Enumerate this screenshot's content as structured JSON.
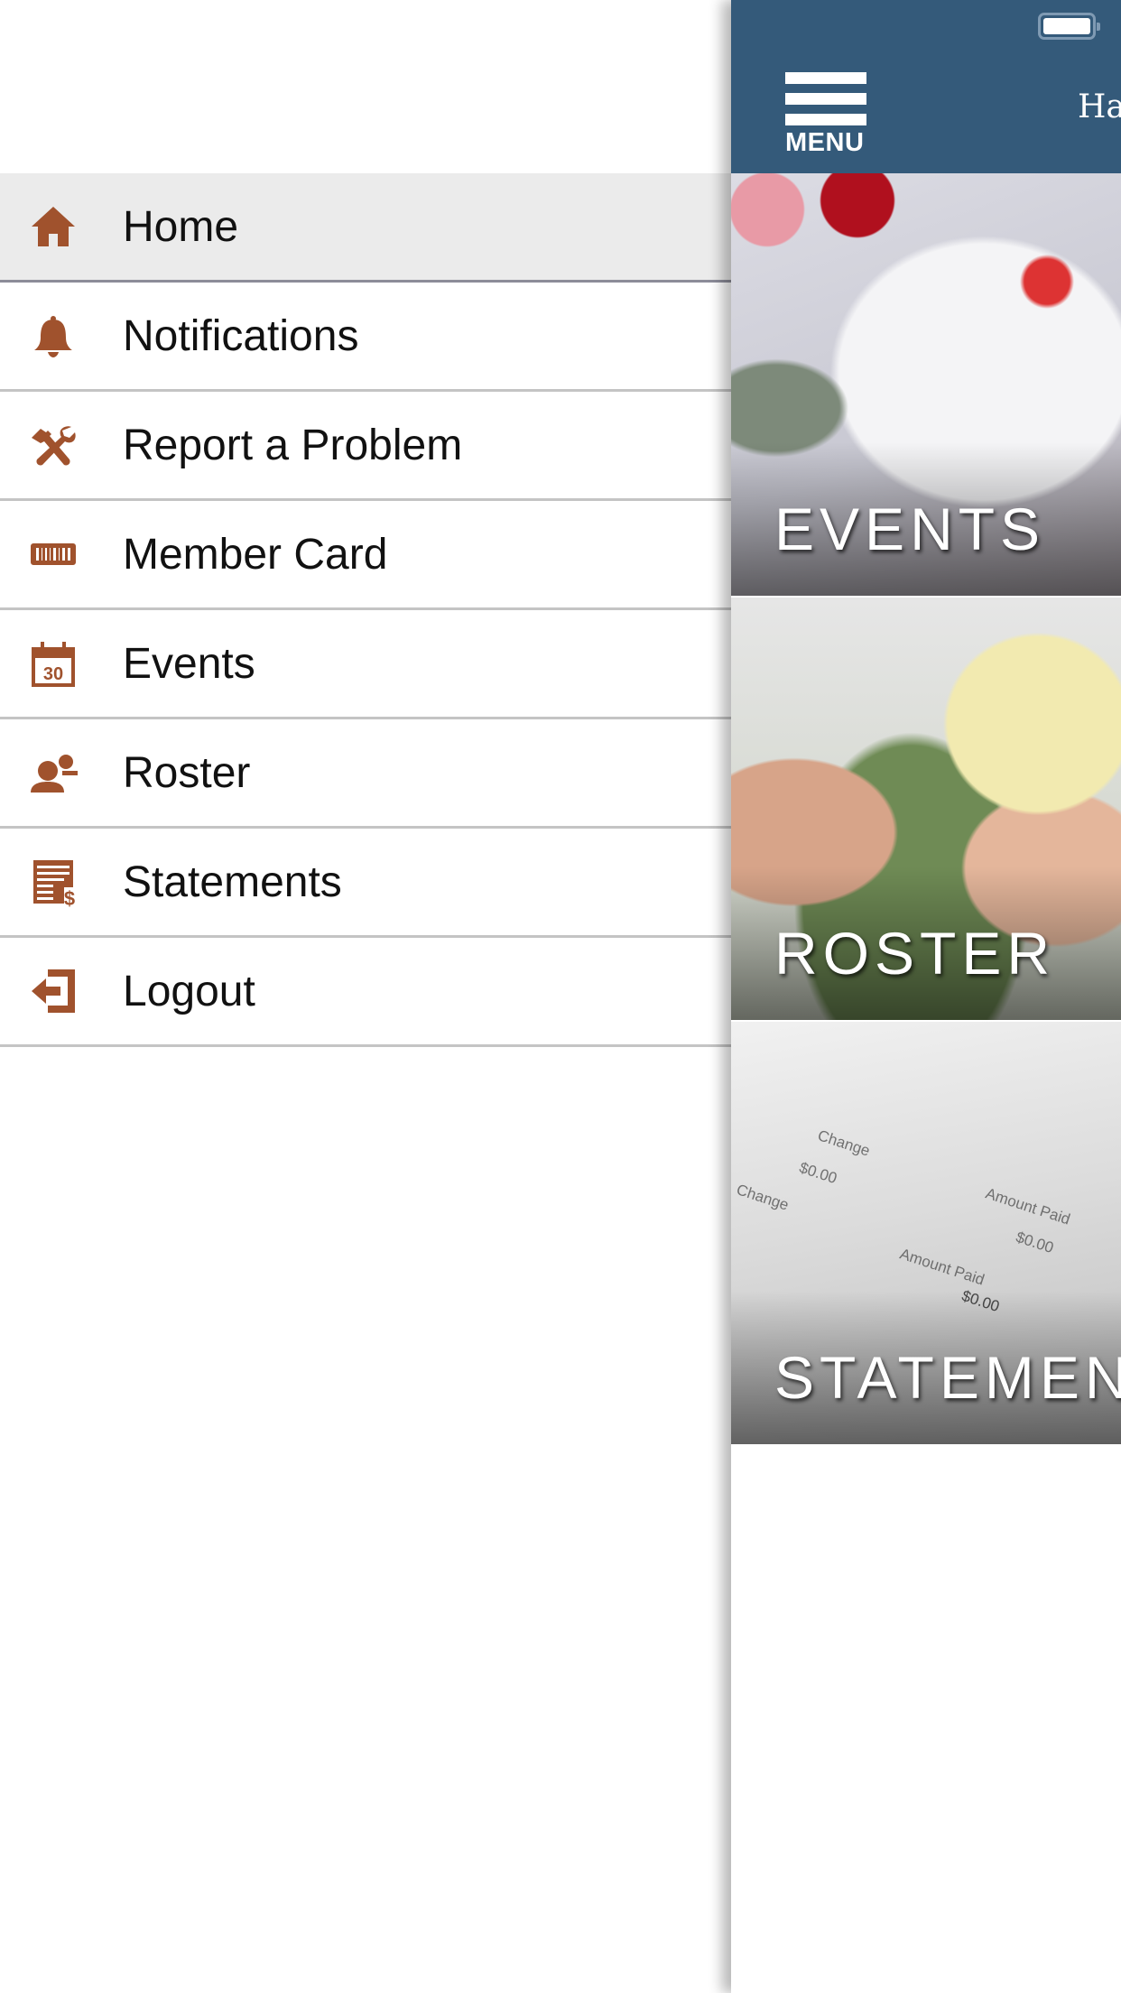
{
  "drawer": {
    "items": [
      {
        "label": "Home",
        "icon": "home-icon",
        "active": true
      },
      {
        "label": "Notifications",
        "icon": "bell-icon"
      },
      {
        "label": "Report a Problem",
        "icon": "tools-icon"
      },
      {
        "label": "Member Card",
        "icon": "barcode-icon"
      },
      {
        "label": "Events",
        "icon": "calendar-icon",
        "calendar_day": "30"
      },
      {
        "label": "Roster",
        "icon": "people-icon"
      },
      {
        "label": "Statements",
        "icon": "statement-icon"
      },
      {
        "label": "Logout",
        "icon": "logout-icon"
      }
    ],
    "icon_color": "#a0522d"
  },
  "header": {
    "menu_label": "MENU",
    "title": "Ha",
    "color": "#345a7a"
  },
  "tiles": [
    {
      "label": "EVENTS"
    },
    {
      "label": "ROSTER"
    },
    {
      "label": "STATEMEN",
      "background_text": [
        "Change",
        "$0.00",
        "Amount Paid",
        "Change",
        "$0.00",
        "Amount Paid",
        "$0.00"
      ]
    }
  ]
}
